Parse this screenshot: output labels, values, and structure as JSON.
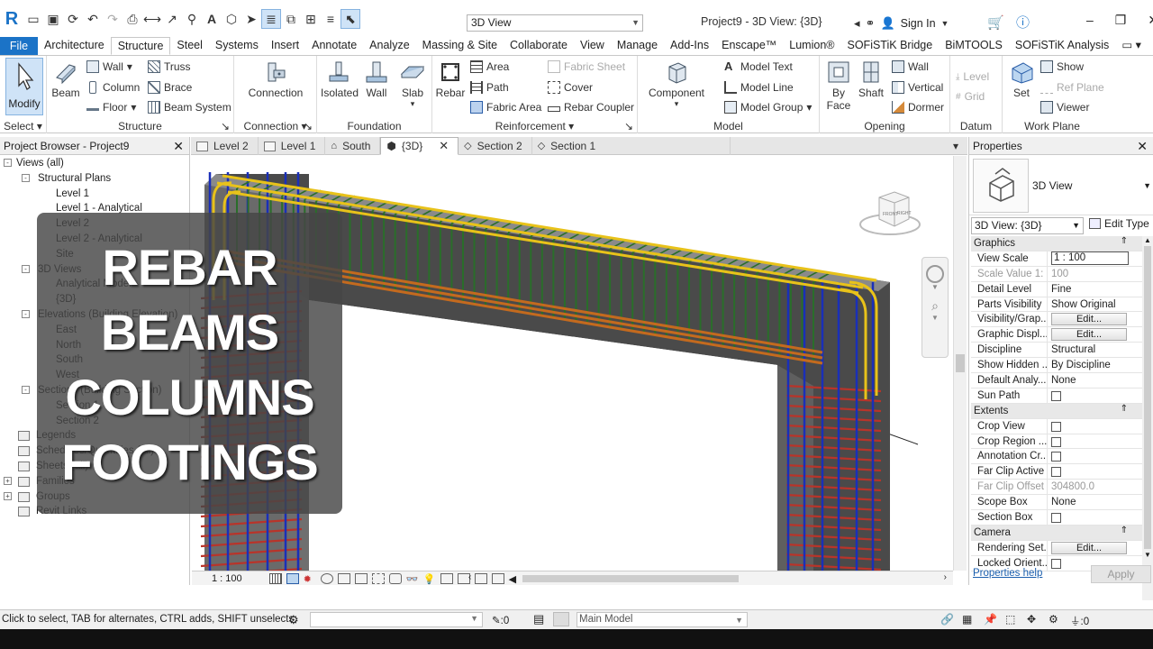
{
  "titlebar": {
    "view_combo_value": "3D View",
    "app_title": "Project9 - 3D View: {3D}",
    "sign_in": "Sign In"
  },
  "ribbon_tabs": {
    "file": "File",
    "tabs": [
      "Architecture",
      "Structure",
      "Steel",
      "Systems",
      "Insert",
      "Annotate",
      "Analyze",
      "Massing & Site",
      "Collaborate",
      "View",
      "Manage",
      "Add-Ins",
      "Enscape™",
      "Lumion®",
      "SOFiSTiK Bridge",
      "BiMTOOLS",
      "SOFiSTiK Analysis"
    ],
    "active": "Structure"
  },
  "ribbon": {
    "select": {
      "modify": "Modify",
      "title": "Select"
    },
    "structure": {
      "beam": "Beam",
      "wall": "Wall",
      "column": "Column",
      "floor": "Floor",
      "truss": "Truss",
      "brace": "Brace",
      "beam_system": "Beam System",
      "title": "Structure"
    },
    "connection": {
      "connection": "Connection",
      "title": "Connection"
    },
    "foundation": {
      "isolated": "Isolated",
      "wall": "Wall",
      "slab": "Slab",
      "title": "Foundation"
    },
    "reinforcement": {
      "rebar": "Rebar",
      "area": "Area",
      "path": "Path",
      "fabric_area": "Fabric  Area",
      "fabric_sheet": "Fabric  Sheet",
      "cover": "Cover",
      "rebar_coupler": "Rebar  Coupler",
      "title": "Reinforcement"
    },
    "model": {
      "component": "Component",
      "model_text": "Model  Text",
      "model_line": "Model  Line",
      "model_group": "Model  Group",
      "title": "Model"
    },
    "opening": {
      "by_face_1": "By",
      "by_face_2": "Face",
      "shaft": "Shaft",
      "wall": "Wall",
      "vertical": "Vertical",
      "dormer": "Dormer",
      "title": "Opening"
    },
    "datum": {
      "level": "Level",
      "grid": "Grid",
      "title": "Datum"
    },
    "workplane": {
      "set": "Set",
      "show": "Show",
      "ref_plane": "Ref  Plane",
      "viewer": "Viewer",
      "title": "Work Plane"
    }
  },
  "project_browser": {
    "title": "Project Browser - Project9",
    "items": [
      {
        "label": "Views (all)",
        "indent": 0,
        "toggle": "-"
      },
      {
        "label": "Structural Plans",
        "indent": 1,
        "toggle": "-"
      },
      {
        "label": "Level 1",
        "indent": 2,
        "toggle": ""
      },
      {
        "label": "Level 1 - Analytical",
        "indent": 2,
        "toggle": ""
      },
      {
        "label": "Level 2",
        "indent": 2,
        "toggle": ""
      },
      {
        "label": "Level 2 - Analytical",
        "indent": 2,
        "toggle": ""
      },
      {
        "label": "Site",
        "indent": 2,
        "toggle": ""
      },
      {
        "label": "3D Views",
        "indent": 1,
        "toggle": "-"
      },
      {
        "label": "Analytical Model",
        "indent": 2,
        "toggle": ""
      },
      {
        "label": "{3D}",
        "indent": 2,
        "toggle": ""
      },
      {
        "label": "Elevations (Building Elevation)",
        "indent": 1,
        "toggle": "-"
      },
      {
        "label": "East",
        "indent": 2,
        "toggle": ""
      },
      {
        "label": "North",
        "indent": 2,
        "toggle": ""
      },
      {
        "label": "South",
        "indent": 2,
        "toggle": ""
      },
      {
        "label": "West",
        "indent": 2,
        "toggle": ""
      },
      {
        "label": "Sections (Building Section)",
        "indent": 1,
        "toggle": "-"
      },
      {
        "label": "Section 1",
        "indent": 2,
        "toggle": ""
      },
      {
        "label": "Section 2",
        "indent": 2,
        "toggle": ""
      },
      {
        "label": "Legends",
        "indent": 0,
        "toggle": ""
      },
      {
        "label": "Schedules/Quantities (all)",
        "indent": 0,
        "toggle": ""
      },
      {
        "label": "Sheets (all)",
        "indent": 0,
        "toggle": ""
      },
      {
        "label": "Families",
        "indent": 0,
        "toggle": "+"
      },
      {
        "label": "Groups",
        "indent": 0,
        "toggle": "+"
      },
      {
        "label": "Revit Links",
        "indent": 0,
        "toggle": ""
      }
    ]
  },
  "overlay": {
    "lines": [
      "REBAR",
      "BEAMS",
      "COLUMNS",
      "FOOTINGS"
    ]
  },
  "view_tabs": [
    "Level 2",
    "Level 1",
    "South",
    "{3D}",
    "Section 2",
    "Section 1"
  ],
  "view_tab_active": "{3D}",
  "view_bar": {
    "scale": "1 : 100"
  },
  "viewcube": {
    "front": "FRONT",
    "right": "RIGHT"
  },
  "properties": {
    "title": "Properties",
    "type_name": "3D View",
    "instance": "3D View: {3D}",
    "edit_type": "Edit Type",
    "rows": [
      {
        "group": "Graphics"
      },
      {
        "k": "View Scale",
        "v": "1 : 100",
        "kind": "box"
      },
      {
        "k": "Scale Value    1:",
        "v": "100",
        "kind": "dim"
      },
      {
        "k": "Detail Level",
        "v": "Fine"
      },
      {
        "k": "Parts Visibility",
        "v": "Show Original"
      },
      {
        "k": "Visibility/Grap...",
        "v": "Edit...",
        "kind": "btn"
      },
      {
        "k": "Graphic Displ...",
        "v": "Edit...",
        "kind": "btn"
      },
      {
        "k": "Discipline",
        "v": "Structural"
      },
      {
        "k": "Show Hidden ...",
        "v": "By Discipline"
      },
      {
        "k": "Default Analy...",
        "v": "None"
      },
      {
        "k": "Sun Path",
        "v": "",
        "kind": "check"
      },
      {
        "group": "Extents"
      },
      {
        "k": "Crop View",
        "v": "",
        "kind": "check"
      },
      {
        "k": "Crop Region ...",
        "v": "",
        "kind": "check"
      },
      {
        "k": "Annotation Cr...",
        "v": "",
        "kind": "check"
      },
      {
        "k": "Far Clip Active",
        "v": "",
        "kind": "check"
      },
      {
        "k": "Far Clip Offset",
        "v": "304800.0",
        "kind": "dim"
      },
      {
        "k": "Scope Box",
        "v": "None"
      },
      {
        "k": "Section Box",
        "v": "",
        "kind": "check"
      },
      {
        "group": "Camera"
      },
      {
        "k": "Rendering Set...",
        "v": "Edit...",
        "kind": "btn"
      },
      {
        "k": "Locked Orient...",
        "v": "",
        "kind": "check"
      }
    ],
    "help": "Properties help",
    "apply": "Apply"
  },
  "statusbar": {
    "text": "Click to select, TAB for alternates, CTRL adds, SHIFT unselects.",
    "count": ":0",
    "model": "Main Model",
    "filter": ":0"
  },
  "colors": {
    "accent": "#1b73c7",
    "concrete": "#5a5a5a",
    "stirrup": "#2a6e2a",
    "rebar_yellow": "#e8c21a",
    "rebar_blue": "#1a2fb8",
    "rebar_red": "#b8342a"
  }
}
